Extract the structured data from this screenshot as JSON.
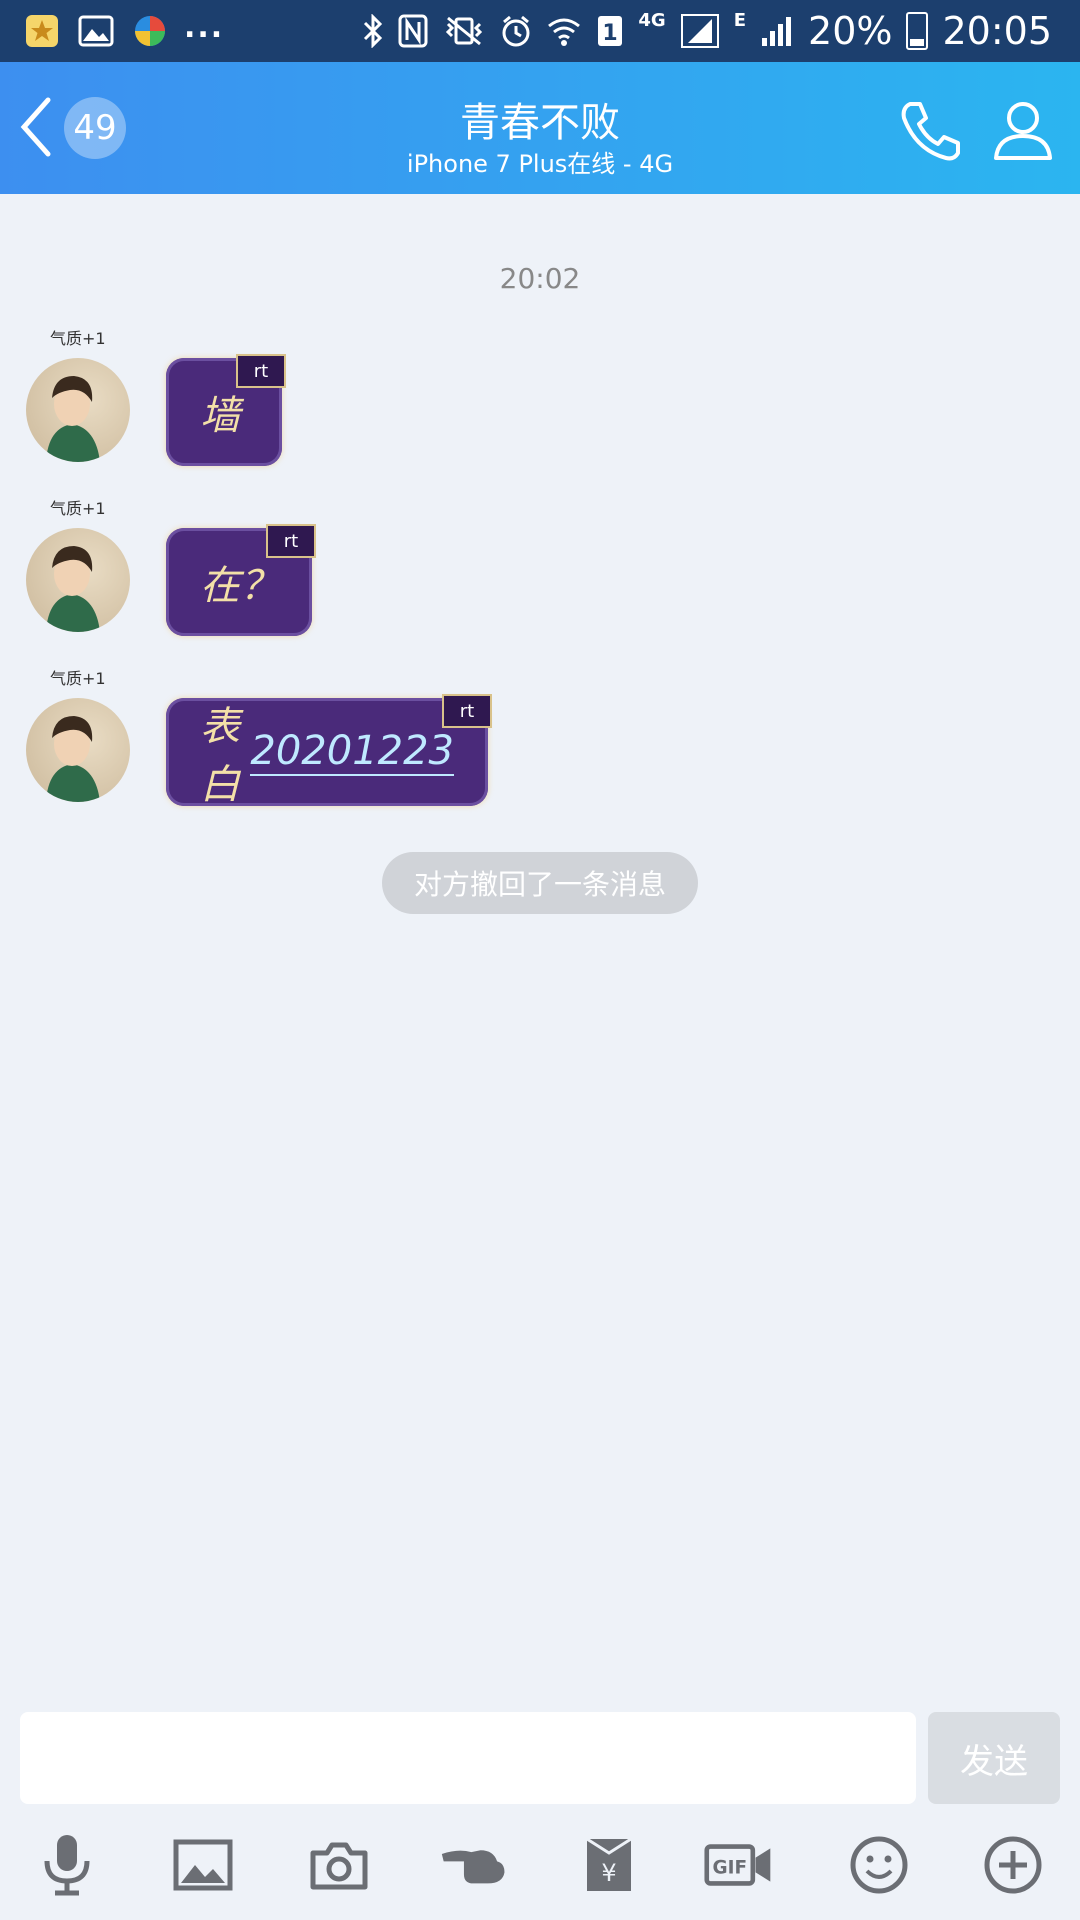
{
  "statusbar": {
    "left_icons": [
      "star-app-icon",
      "gallery-icon",
      "colorful-app-icon"
    ],
    "more": "...",
    "network_label": "4G",
    "data_label": "E",
    "battery": "20%",
    "time": "20:05"
  },
  "header": {
    "unread_count": "49",
    "title": "青春不败",
    "subtitle": "iPhone 7 Plus在线 - 4G"
  },
  "chat": {
    "timestamp": "20:02",
    "messages": [
      {
        "text": "墙",
        "tag": "rt"
      },
      {
        "text": "在？",
        "tag": "rt"
      },
      {
        "text": "表白",
        "extra": "20201223",
        "tag": "rt"
      }
    ],
    "avatar_tags": [
      "气质+1",
      "气质+1",
      "气质+1"
    ],
    "recall_notice": "对方撤回了一条消息"
  },
  "composer": {
    "input_value": "",
    "send_label": "发送"
  },
  "toolbar": {
    "items": [
      "mic-icon",
      "image-icon",
      "camera-icon",
      "poke-icon",
      "red-packet-icon",
      "gif-icon",
      "emoji-icon",
      "plus-icon"
    ]
  },
  "colors": {
    "header_start": "#3d8ff0",
    "header_end": "#2bb5f0",
    "bubble": "#4a2a7a",
    "background": "#eef2f8"
  }
}
